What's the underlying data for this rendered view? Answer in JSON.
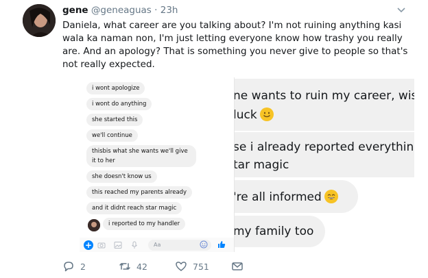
{
  "tweet": {
    "name": "gene",
    "handle": "@geneaguas",
    "dot": "·",
    "time": "23h",
    "text": "Daniela, what career are you talking about? I'm not ruining anything kasi wala ka naman non, I'm just letting everyone know how trashy you really are. And an apology? That is something you never give to people so that's not really expected."
  },
  "left_screenshot": {
    "messages": [
      "i wont apologize",
      "i wont do anything",
      "she started this",
      "we'll continue",
      "thisbis what she wants we'll give it to her",
      "she doesn't know us",
      "this reached my parents already",
      "and it didnt reach star magic",
      "i reported to my handler"
    ],
    "composer_placeholder": "Aa"
  },
  "right_screenshot": {
    "bubble1_line1": "ne wants to ruin my career, wis",
    "bubble1_line2": "luck",
    "bubble2_line1": "se i already reported everythin",
    "bubble2_line2": "tar magic",
    "bubble3": "'re all informed",
    "bubble4": "my family too"
  },
  "actions": {
    "replies": "2",
    "retweets": "42",
    "likes": "751"
  },
  "colors": {
    "messenger_blue": "#0084ff",
    "bubble_gray": "#f0f0f0",
    "meta_gray": "#657786"
  }
}
